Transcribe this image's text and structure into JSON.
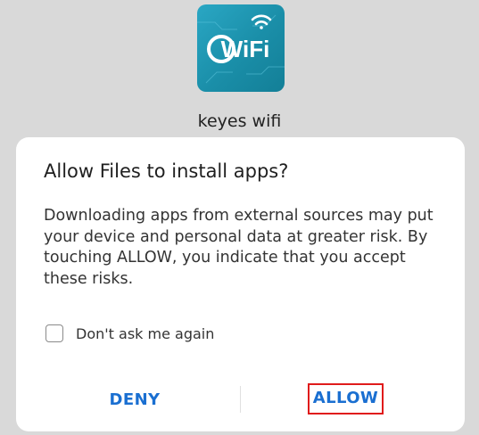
{
  "app": {
    "icon_name": "wifi-app-icon",
    "icon_text": "WiFi",
    "name": "keyes wifi"
  },
  "dialog": {
    "title": "Allow Files to install apps?",
    "message": "Downloading apps from external sources may put your device and personal data at greater risk. By touching ALLOW, you indicate that you accept these risks.",
    "checkbox_label": "Don't ask me again",
    "checkbox_checked": false,
    "deny_label": "DENY",
    "allow_label": "ALLOW"
  },
  "colors": {
    "accent": "#1a6fd1",
    "highlight_box": "#e01b1b",
    "backdrop": "#d9d9d9",
    "icon_background": "#1a8ea8"
  }
}
